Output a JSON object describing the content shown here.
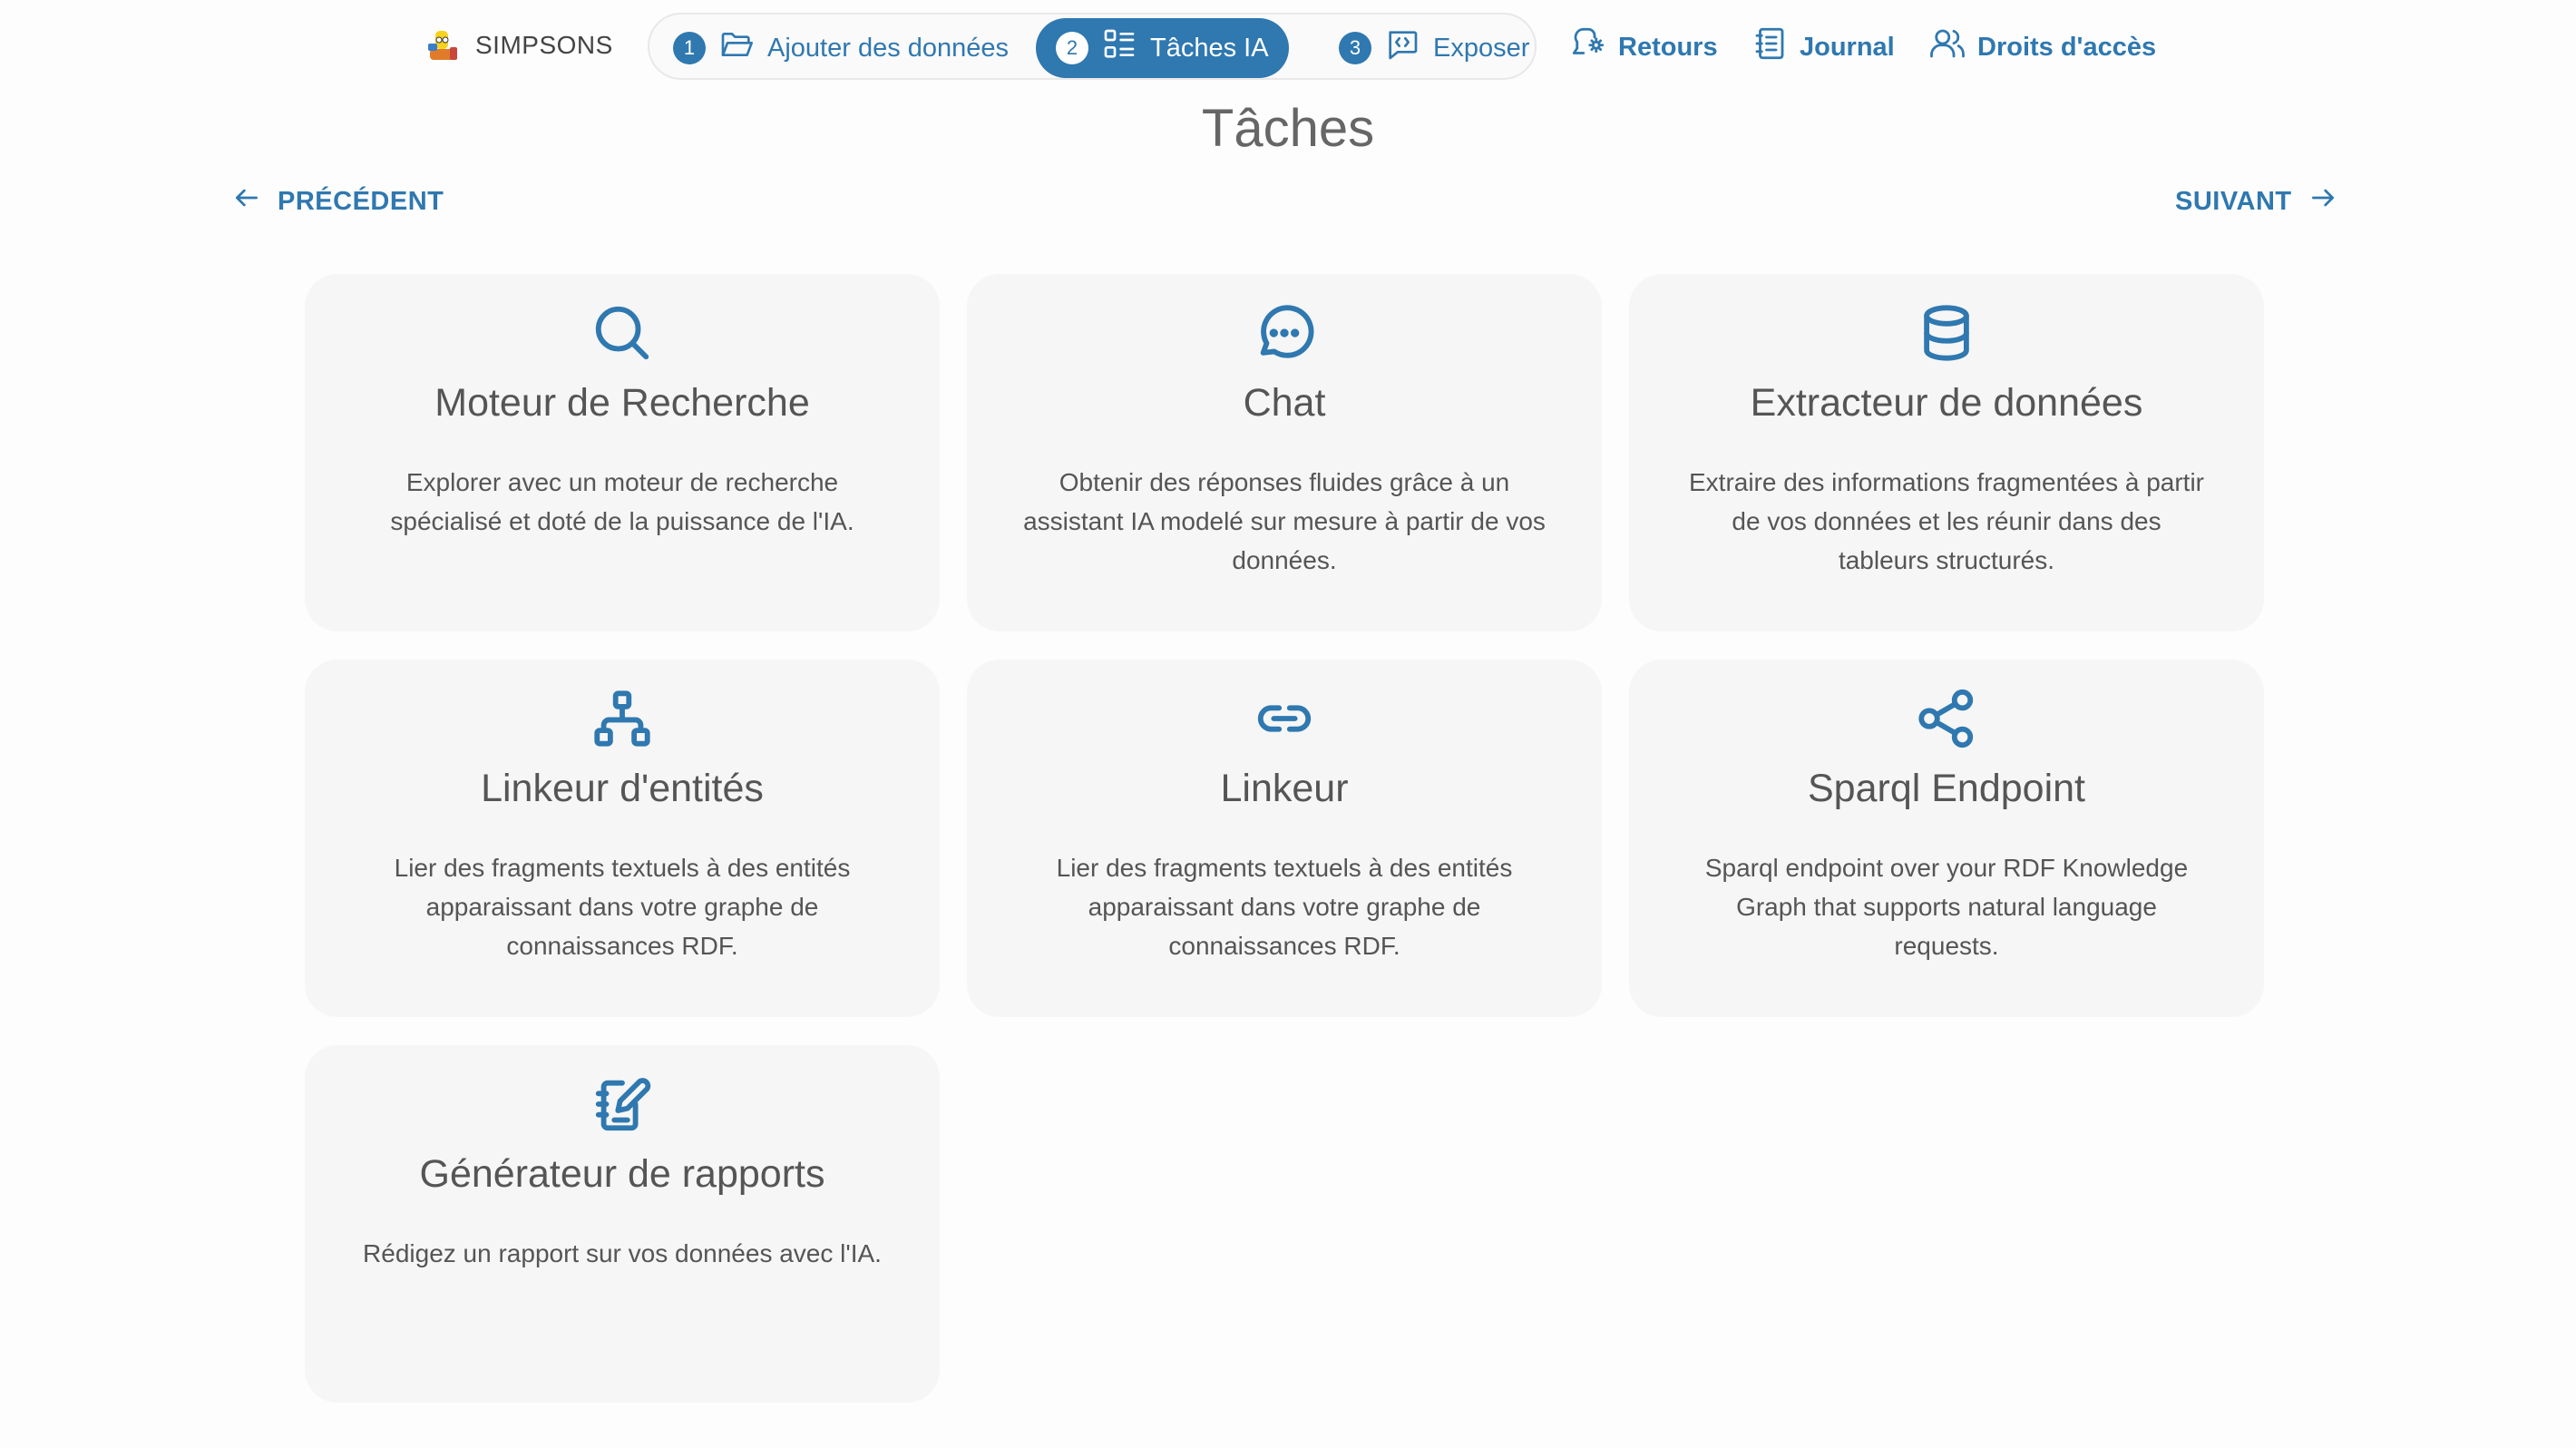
{
  "header": {
    "brand": "SIMPSONS",
    "steps": [
      {
        "number": "1",
        "label": "Ajouter des données",
        "icon": "folder-icon"
      },
      {
        "number": "2",
        "label": "Tâches IA",
        "icon": "tasks-list-icon",
        "active": true
      },
      {
        "number": "3",
        "label": "Exposer",
        "icon": "message-code-icon"
      }
    ],
    "links": [
      {
        "label": "Retours",
        "icon": "feedback-icon"
      },
      {
        "label": "Journal",
        "icon": "journal-icon"
      },
      {
        "label": "Droits d'accès",
        "icon": "users-icon"
      }
    ]
  },
  "page": {
    "title": "Tâches",
    "prev_label": "PRÉCÉDENT",
    "next_label": "SUIVANT"
  },
  "cards": [
    {
      "title": "Moteur de Recherche",
      "description": "Explorer avec un moteur de recherche spécialisé et doté de la puissance de l'IA.",
      "icon": "search-icon"
    },
    {
      "title": "Chat",
      "description": "Obtenir des réponses fluides grâce à un assistant IA modelé sur mesure à partir de vos données.",
      "icon": "chat-bubble-icon"
    },
    {
      "title": "Extracteur de données",
      "description": "Extraire des informations fragmentées à partir de vos données et les réunir dans des tableurs structurés.",
      "icon": "database-icon"
    },
    {
      "title": "Linkeur d'entités",
      "description": "Lier des fragments textuels à des entités apparaissant dans votre graphe de connaissances RDF.",
      "icon": "hierarchy-icon"
    },
    {
      "title": "Linkeur",
      "description": "Lier des fragments textuels à des entités apparaissant dans votre graphe de connaissances RDF.",
      "icon": "link-icon"
    },
    {
      "title": "Sparql Endpoint",
      "description": "Sparql endpoint over your RDF Knowledge Graph that supports natural language requests.",
      "icon": "share-icon"
    },
    {
      "title": "Générateur de rapports",
      "description": "Rédigez un rapport sur vos données avec l'IA.",
      "icon": "notebook-edit-icon"
    }
  ],
  "colors": {
    "accent": "#2f78b0",
    "card_background": "#f6f6f6",
    "text": "#555555"
  }
}
